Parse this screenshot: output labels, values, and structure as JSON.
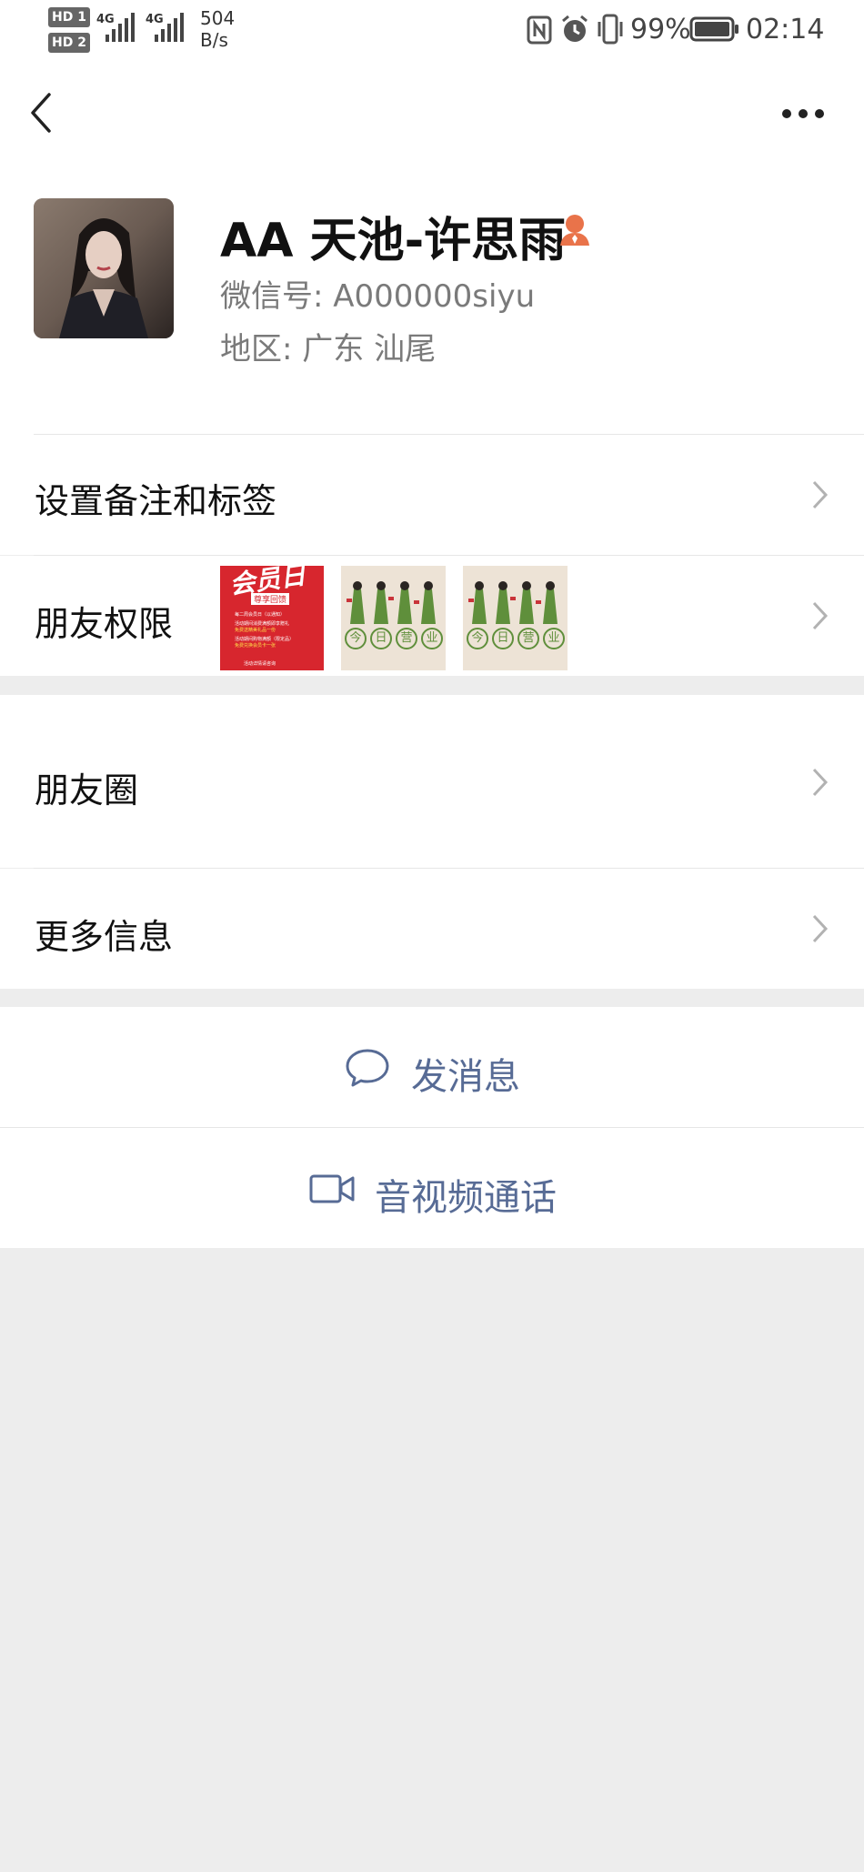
{
  "status_bar": {
    "hd1": "HD 1",
    "hd2": "HD 2",
    "net1": "4G",
    "net2": "4G",
    "speed_value": "504",
    "speed_unit": "B/s",
    "battery": "99%",
    "time": "02:14"
  },
  "profile": {
    "name": "AA 天池-许思雨",
    "wechat_id": "微信号:  A000000siyu",
    "region": "地区:  广东  汕尾"
  },
  "menu": {
    "remark_tags": "设置备注和标签",
    "friend_permissions": "朋友权限",
    "moments": "朋友圈",
    "more_info": "更多信息"
  },
  "moments_thumbs": {
    "t1_title": "会员日",
    "t1_sub": "尊享回馈",
    "t1_line1": "每二周会员日（以通知）",
    "t1_line2": "活动期间消费满额即享赠礼",
    "t1_line3": "免费送精美礼品一份",
    "t1_line4": "活动期间购物满额（限定品）",
    "t1_line5": "免费兑换会员卡一张",
    "t1_footer": "活动详情请咨询",
    "t2_chars": [
      "今",
      "日",
      "营",
      "业"
    ],
    "t3_chars": [
      "今",
      "日",
      "营",
      "业"
    ]
  },
  "actions": {
    "send_message": "发消息",
    "av_call": "音视频通话"
  },
  "colors": {
    "link_blue": "#576b95",
    "badge_orange": "#e9734a",
    "thumb_red": "#d7262e",
    "thumb_beige": "#ede3d6",
    "thumb_green": "#5f8f3b"
  }
}
